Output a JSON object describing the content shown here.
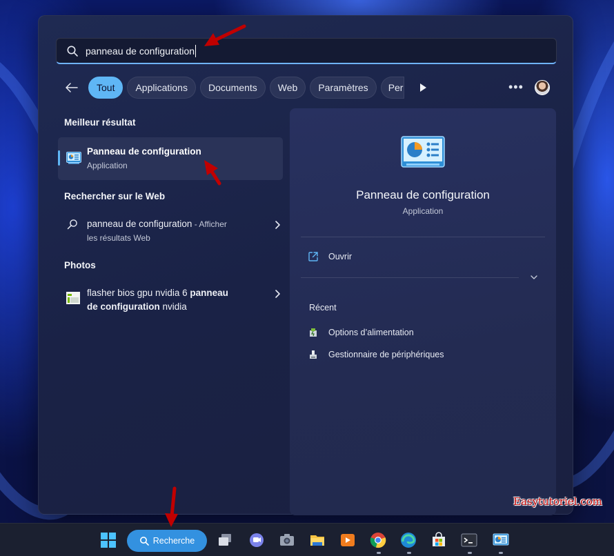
{
  "search": {
    "query": "panneau de configuration"
  },
  "filters": [
    "Tout",
    "Applications",
    "Documents",
    "Web",
    "Paramètres",
    "Pers"
  ],
  "sections": {
    "best_match": "Meilleur résultat",
    "web": "Rechercher sur le Web",
    "photos": "Photos"
  },
  "best_result": {
    "title": "Panneau de configuration",
    "type": "Application"
  },
  "web_result": {
    "query": "panneau de configuration",
    "suffix": " - Afficher",
    "line2": "les résultats Web"
  },
  "photo_result": {
    "prefix": "flasher bios gpu nvidia 6 ",
    "bold1": "panneau",
    "bold2": "de configuration",
    "suffix": " nvidia"
  },
  "details": {
    "title": "Panneau de configuration",
    "type": "Application",
    "open_label": "Ouvrir",
    "recent_heading": "Récent",
    "recent_items": [
      "Options d’alimentation",
      "Gestionnaire de périphériques"
    ]
  },
  "taskbar": {
    "search_label": "Recherche"
  },
  "watermark": "Easytutoriel.com",
  "colors": {
    "accent": "#5fb6f5",
    "arrow": "#c00000",
    "taskbar_search": "#3391e0"
  }
}
